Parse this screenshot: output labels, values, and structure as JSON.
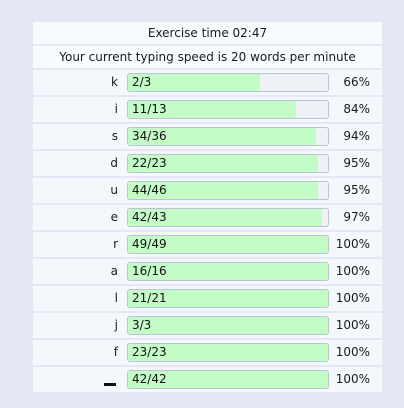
{
  "header": {
    "exercise_time": "Exercise time 02:47",
    "speed": "Your current typing speed is 20 words per minute"
  },
  "stats": [
    {
      "key": "k",
      "score": "2/3",
      "percent": "66%",
      "fill": 0.66
    },
    {
      "key": "i",
      "score": "11/13",
      "percent": "84%",
      "fill": 0.84
    },
    {
      "key": "s",
      "score": "34/36",
      "percent": "94%",
      "fill": 0.94
    },
    {
      "key": "d",
      "score": "22/23",
      "percent": "95%",
      "fill": 0.95
    },
    {
      "key": "u",
      "score": "44/46",
      "percent": "95%",
      "fill": 0.95
    },
    {
      "key": "e",
      "score": "42/43",
      "percent": "97%",
      "fill": 0.97
    },
    {
      "key": "r",
      "score": "49/49",
      "percent": "100%",
      "fill": 1.0
    },
    {
      "key": "a",
      "score": "16/16",
      "percent": "100%",
      "fill": 1.0
    },
    {
      "key": "l",
      "score": "21/21",
      "percent": "100%",
      "fill": 1.0
    },
    {
      "key": "j",
      "score": "3/3",
      "percent": "100%",
      "fill": 1.0
    },
    {
      "key": "f",
      "score": "23/23",
      "percent": "100%",
      "fill": 1.0
    },
    {
      "key": "space",
      "score": "42/42",
      "percent": "100%",
      "fill": 1.0
    }
  ],
  "colors": {
    "fill": "#c4fcc8",
    "track": "#eef2f6",
    "background": "#e4e8f4"
  }
}
